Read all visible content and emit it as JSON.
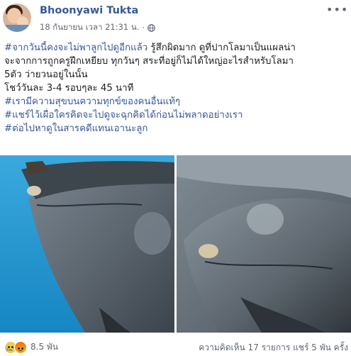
{
  "post": {
    "author": "Bhoonyawi Tukta",
    "timestamp": "18 กันยายน เวลา 21:31 น.",
    "privacy_icon": "globe-icon",
    "more_icon": "more-options-icon",
    "lines": [
      [
        {
          "text": "#จากวันนี้คงจะไม่พาลูกไปดูอีกแล้ว",
          "tag": true
        },
        {
          "text": " รู้สึกผิดมาก ดูที่ปากโลมาเป็นแผลน่า",
          "tag": false
        }
      ],
      [
        {
          "text": "จะจากการถูกครูฝึกเหยียบ ทุกวันๆ สระที่อยู่ก็ไม่ได้ใหญ่อะไรสำหรับโลมา",
          "tag": false
        }
      ],
      [
        {
          "text": "5ตัว ว่ายวนอยู่ในนั้น",
          "tag": false
        }
      ],
      [
        {
          "text": "โชว์วันละ 3-4 รอบๆละ 45 นาที",
          "tag": false
        }
      ],
      [
        {
          "text": "#เรามีความสุขบนความทุกข์ของคนอื่นแท้ๆ",
          "tag": true
        }
      ],
      [
        {
          "text": "#แชร์ไว้เผื่อใครคิดจะไปดูจะฉุกคิดได้ก่อนไม่พลาดอย่างเรา",
          "tag": true
        }
      ],
      [
        {
          "text": "#ต่อไปหาดูในสารคดีแทนเอานะลูก",
          "tag": true
        }
      ]
    ]
  },
  "photos": [
    {
      "name": "dolphin-photo-left"
    },
    {
      "name": "dolphin-photo-right"
    }
  ],
  "footer": {
    "reaction_icons": [
      "sad-reaction-icon",
      "angry-reaction-icon"
    ],
    "reaction_count": "8.5 พัน",
    "comments": "ความคิดเห็น 17 รายการ",
    "shares": "แชร์ 5 พัน ครั้ง"
  },
  "colors": {
    "link": "#385898",
    "secondary_text": "#606770",
    "pool_blue": "#1e9fd6"
  }
}
